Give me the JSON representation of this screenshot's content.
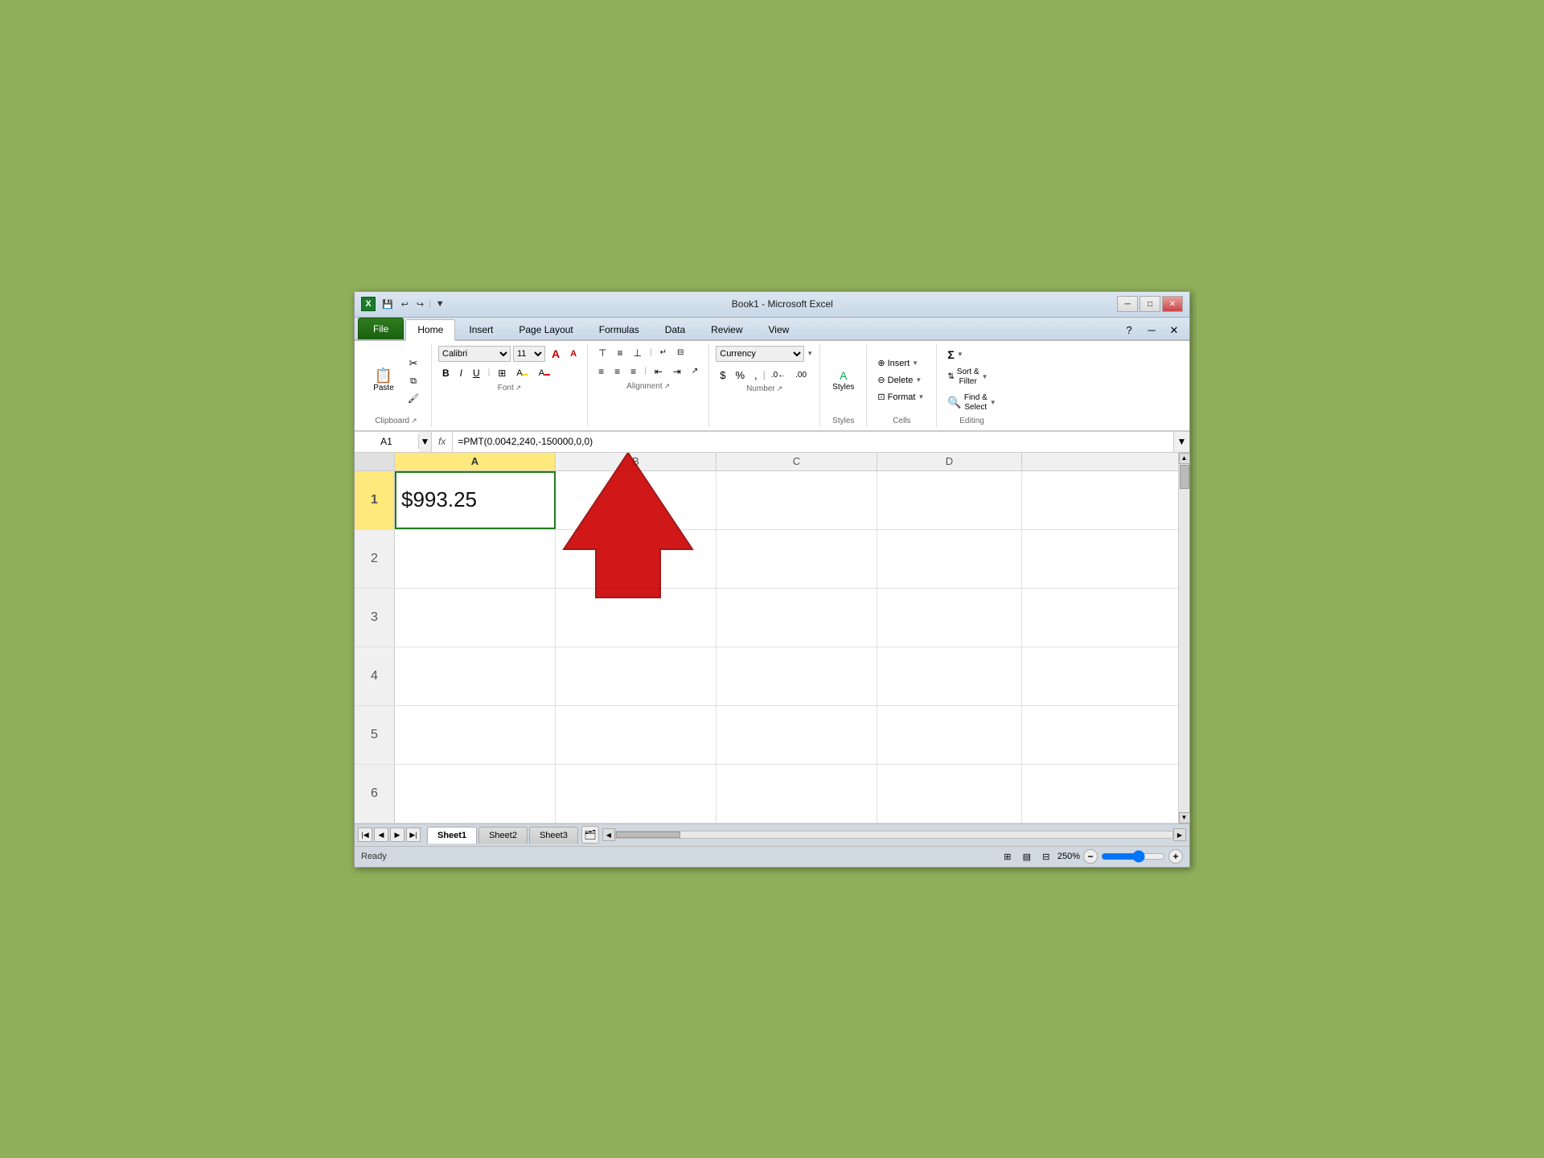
{
  "window": {
    "title": "Book1 - Microsoft Excel",
    "icon": "X"
  },
  "titlebar": {
    "quick_access": [
      "save",
      "undo",
      "redo",
      "customize"
    ],
    "controls": [
      "minimize",
      "maximize",
      "close"
    ]
  },
  "tabs": [
    {
      "id": "file",
      "label": "File",
      "active": false,
      "file": true
    },
    {
      "id": "home",
      "label": "Home",
      "active": true
    },
    {
      "id": "insert",
      "label": "Insert"
    },
    {
      "id": "page_layout",
      "label": "Page Layout"
    },
    {
      "id": "formulas",
      "label": "Formulas"
    },
    {
      "id": "data",
      "label": "Data"
    },
    {
      "id": "review",
      "label": "Review"
    },
    {
      "id": "view",
      "label": "View"
    }
  ],
  "ribbon": {
    "clipboard_label": "Clipboard",
    "font_label": "Font",
    "alignment_label": "Alignment",
    "number_label": "Number",
    "styles_label": "Styles",
    "cells_label": "Cells",
    "editing_label": "Editing",
    "font_name": "Calibri",
    "font_size": "11",
    "bold": "B",
    "italic": "I",
    "underline": "U",
    "number_format": "Currency",
    "paste_label": "Paste",
    "sort_filter_label": "Sort &\nFilter",
    "find_select_label": "Find &\nSelect",
    "format_label": "Format",
    "insert_label": "Insert",
    "delete_label": "Delete",
    "styles_btn_label": "Styles",
    "sum_label": "Σ",
    "sum_btn": "AutoSum"
  },
  "formula_bar": {
    "cell_ref": "A1",
    "formula": "=PMT(0.0042,240,-150000,0,0)",
    "fx": "fx"
  },
  "grid": {
    "columns": [
      "A",
      "B",
      "C",
      "D"
    ],
    "rows": [
      {
        "id": 1,
        "cells": [
          {
            "col": "A",
            "value": "$993.25",
            "selected": true
          },
          {
            "col": "B",
            "value": ""
          },
          {
            "col": "C",
            "value": ""
          },
          {
            "col": "D",
            "value": ""
          }
        ]
      },
      {
        "id": 2,
        "cells": [
          {
            "col": "A",
            "value": ""
          },
          {
            "col": "B",
            "value": ""
          },
          {
            "col": "C",
            "value": ""
          },
          {
            "col": "D",
            "value": ""
          }
        ]
      },
      {
        "id": 3,
        "cells": [
          {
            "col": "A",
            "value": ""
          },
          {
            "col": "B",
            "value": ""
          },
          {
            "col": "C",
            "value": ""
          },
          {
            "col": "D",
            "value": ""
          }
        ]
      },
      {
        "id": 4,
        "cells": [
          {
            "col": "A",
            "value": ""
          },
          {
            "col": "B",
            "value": ""
          },
          {
            "col": "C",
            "value": ""
          },
          {
            "col": "D",
            "value": ""
          }
        ]
      },
      {
        "id": 5,
        "cells": [
          {
            "col": "A",
            "value": ""
          },
          {
            "col": "B",
            "value": ""
          },
          {
            "col": "C",
            "value": ""
          },
          {
            "col": "D",
            "value": ""
          }
        ]
      },
      {
        "id": 6,
        "cells": [
          {
            "col": "A",
            "value": ""
          },
          {
            "col": "B",
            "value": ""
          },
          {
            "col": "C",
            "value": ""
          },
          {
            "col": "D",
            "value": ""
          }
        ]
      }
    ]
  },
  "sheet_tabs": [
    {
      "label": "Sheet1",
      "active": true
    },
    {
      "label": "Sheet2",
      "active": false
    },
    {
      "label": "Sheet3",
      "active": false
    }
  ],
  "status": {
    "text": "Ready",
    "zoom": "250%"
  },
  "colors": {
    "active_col_header": "#ffe87c",
    "active_row_header": "#ffe87c",
    "selected_cell_border": "#1e7c1e",
    "file_tab": "#2e7d1e",
    "ribbon_bg": "white",
    "green_body": "#8faf5a"
  }
}
